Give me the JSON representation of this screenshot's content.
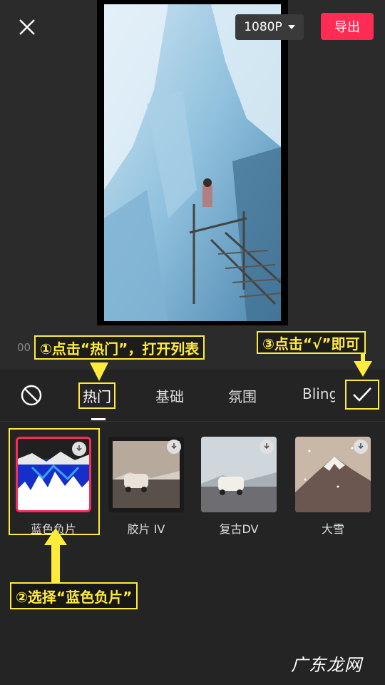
{
  "header": {
    "resolution": "1080P",
    "export_label": "导出"
  },
  "timecode": "00",
  "tabs": {
    "hot": "热门",
    "basic": "基础",
    "atmosphere": "氛围",
    "bling": "Bling"
  },
  "filters": [
    {
      "label": "蓝色负片"
    },
    {
      "label": "胶片 IV"
    },
    {
      "label": "复古DV"
    },
    {
      "label": "大雪"
    }
  ],
  "annotations": {
    "step1": "①点击“热门”，打开列表",
    "step2": "②选择“蓝色负片”",
    "step3": "③点击“√”即可"
  },
  "watermark": "广东龙网",
  "colors": {
    "accent": "#fe2c55",
    "annotation": "#ffeb3b",
    "background": "#2b2b2b"
  }
}
